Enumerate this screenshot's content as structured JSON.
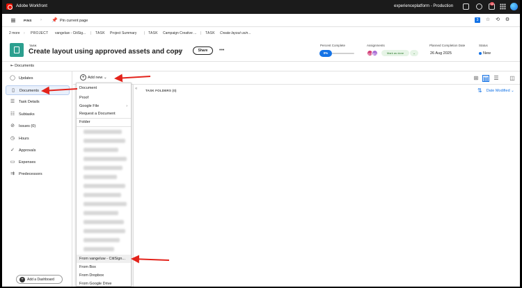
{
  "app": {
    "title": "Adobe Workfront",
    "environment": "experienceplatform - Production",
    "notification_count": "10",
    "pinned_count": "3"
  },
  "pins": {
    "label": "PINS",
    "pin_current": "Pin current page"
  },
  "breadcrumb": {
    "more": "2 more",
    "items": [
      {
        "tag": "PROJECT",
        "name": "vangeluw - CitiSig..."
      },
      {
        "tag": "TASK",
        "name": "Project Summary"
      },
      {
        "tag": "TASK",
        "name": "Campaign Creative ..."
      },
      {
        "tag": "TASK",
        "name": "Create layout usin..."
      }
    ]
  },
  "header": {
    "object_type": "TASK",
    "title": "Create layout using approved assets and copy",
    "share_label": "Share",
    "percent_complete_label": "Percent Complete",
    "percent_complete_value": "0%",
    "percent_complete": 0,
    "assignments_label": "Assignments",
    "assignees": [
      "SG",
      "BG"
    ],
    "mark_done_label": "Mark as done",
    "planned_completion_label": "Planned Completion Date",
    "planned_completion_value": "26 Aug 2025",
    "status_label": "Status",
    "status_value": "New"
  },
  "section_crumb": "Documents",
  "sidebar": {
    "items": [
      {
        "label": "Updates",
        "icon": "chat-bubble-icon"
      },
      {
        "label": "Documents",
        "icon": "document-icon",
        "active": true
      },
      {
        "label": "Task Details",
        "icon": "list-icon"
      },
      {
        "label": "Subtasks",
        "icon": "subtasks-icon"
      },
      {
        "label": "Issues (0)",
        "icon": "issues-icon"
      },
      {
        "label": "Hours",
        "icon": "clock-icon"
      },
      {
        "label": "Approvals",
        "icon": "approvals-icon"
      },
      {
        "label": "Expenses",
        "icon": "expenses-icon"
      },
      {
        "label": "Predecessors",
        "icon": "predecessors-icon"
      }
    ],
    "add_dashboard": "Add a Dashboard"
  },
  "toolbar": {
    "add_new": "Add new"
  },
  "content": {
    "task_folders": "TASK FOLDERS (0)",
    "sort_label": "Date Modified"
  },
  "add_menu": {
    "items_top": [
      "Document",
      "Proof",
      "Google File",
      "Request a Document"
    ],
    "folder": "Folder",
    "items_bottom": [
      "From vangeluw - CitiSign...",
      "From Box",
      "From Dropbox",
      "From Google Drive"
    ]
  },
  "colors": {
    "accent": "#1473e6",
    "annotation_arrow": "#e3231b",
    "task_icon": "#2c9f8f"
  }
}
